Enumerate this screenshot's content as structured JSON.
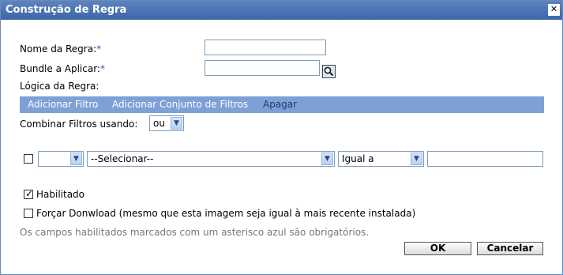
{
  "dialog": {
    "title": "Construção de Regra",
    "close_icon": "close-icon"
  },
  "form": {
    "rule_name_label": "Nome da Regra:",
    "bundle_label": "Bundle a Aplicar:",
    "required_marker": "*",
    "logic_label": "Lógica da Regra:",
    "rule_name_value": "",
    "bundle_value": ""
  },
  "toolbar": {
    "add_filter": "Adicionar Filtro",
    "add_filter_set": "Adicionar Conjunto de Filtros",
    "delete": "Apagar"
  },
  "combine": {
    "label": "Combinar Filtros usando:",
    "value": "ou"
  },
  "filter_row": {
    "checked": false,
    "first_select": "",
    "attribute_select": "--Selecionar--",
    "operator_select": "Igual a",
    "value": ""
  },
  "options": {
    "enabled_label": "Habilitado",
    "enabled_checked": true,
    "force_label": "Forçar Donwload (mesmo que esta imagem seja igual à mais recente instalada)",
    "force_checked": false
  },
  "footer_note": "Os campos habilitados marcados com um asterisco azul são obrigatórios.",
  "buttons": {
    "ok": "OK",
    "cancel": "Cancelar"
  }
}
